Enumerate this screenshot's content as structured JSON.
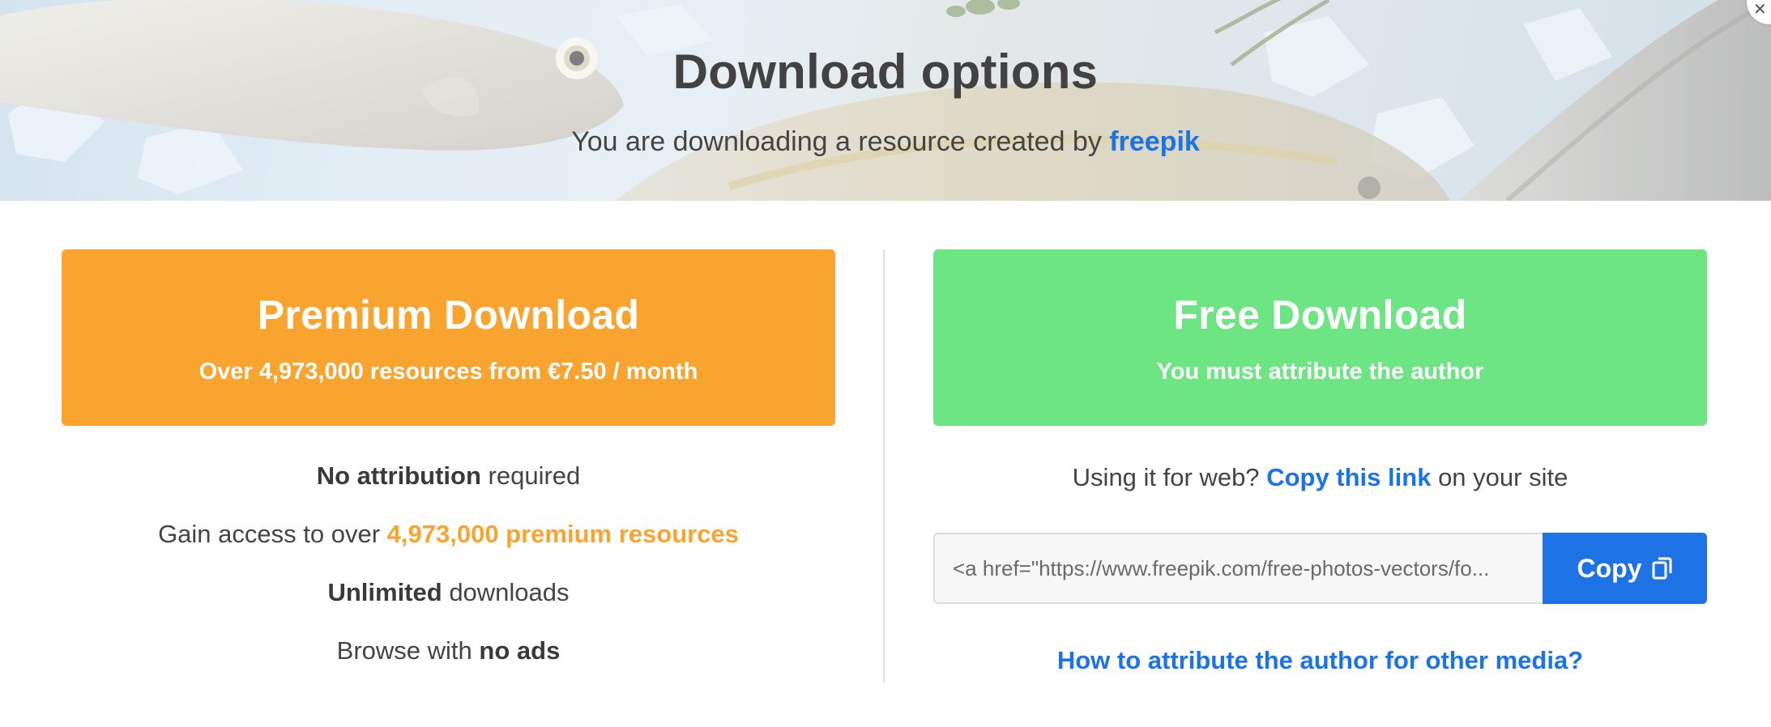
{
  "hero": {
    "title": "Download options",
    "subtitle_prefix": "You are downloading a resource created by",
    "author": "freepik"
  },
  "premium": {
    "title": "Premium Download",
    "subtitle": "Over 4,973,000 resources from €7.50 / month",
    "perks": {
      "p1_bold": "No attribution",
      "p1_rest": "required",
      "p2_prefix": "Gain access to over",
      "p2_highlight": "4,973,000 premium resources",
      "p3_bold": "Unlimited",
      "p3_rest": "downloads",
      "p4_prefix": "Browse with",
      "p4_bold": "no ads"
    }
  },
  "free": {
    "title": "Free Download",
    "subtitle": "You must attribute the author",
    "web_prefix": "Using it for web?",
    "web_link": "Copy this link",
    "web_suffix": "on your site",
    "attribution_code": "<a href=\"https://www.freepik.com/free-photos-vectors/fo...",
    "copy_label": "Copy",
    "other_media_link": "How to attribute the author for other media?"
  },
  "colors": {
    "premium": "#f9a42e",
    "free": "#6de582",
    "link": "#1a73e8",
    "copy_button": "#1d73e3"
  },
  "icons": {
    "copy": "copy-icon",
    "close": "close-icon"
  }
}
